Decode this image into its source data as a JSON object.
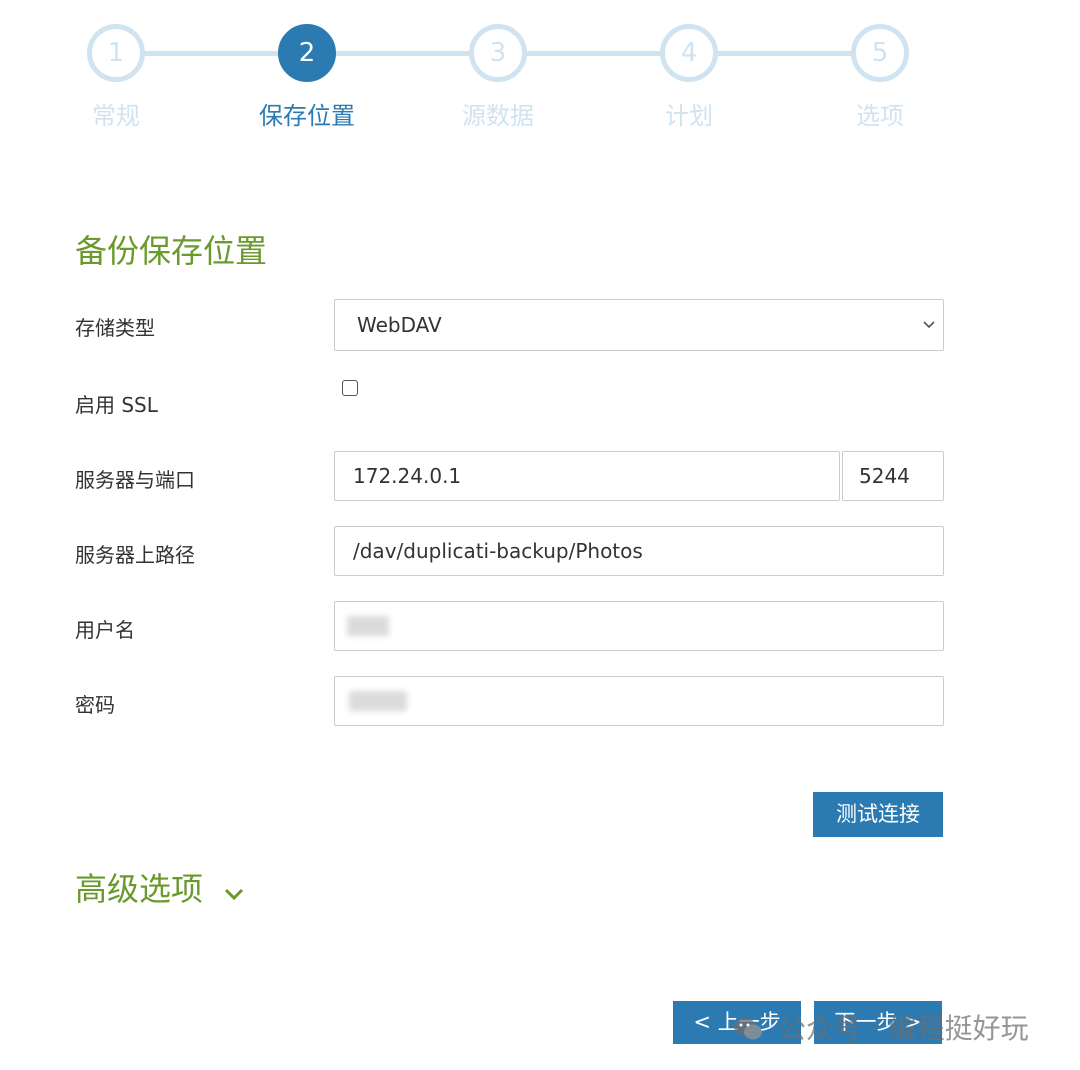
{
  "wizard": {
    "steps": [
      {
        "number": "1",
        "label": "常规"
      },
      {
        "number": "2",
        "label": "保存位置"
      },
      {
        "number": "3",
        "label": "源数据"
      },
      {
        "number": "4",
        "label": "计划"
      },
      {
        "number": "5",
        "label": "选项"
      }
    ],
    "active_step": 2
  },
  "form": {
    "title": "备份保存位置",
    "storage_type": {
      "label": "存储类型",
      "value": "WebDAV"
    },
    "ssl": {
      "label": "启用 SSL",
      "checked": false
    },
    "server": {
      "label": "服务器与端口",
      "host": "172.24.0.1",
      "port": "5244"
    },
    "path": {
      "label": "服务器上路径",
      "value": "/dav/duplicati-backup/Photos"
    },
    "username": {
      "label": "用户名"
    },
    "password": {
      "label": "密码"
    },
    "test_button": "测试连接"
  },
  "advanced": {
    "label": "高级选项"
  },
  "nav": {
    "prev": "< 上一步",
    "next": "下一步 >"
  },
  "watermark": {
    "text": "公众号 · 编程挺好玩"
  },
  "colors": {
    "accent_blue": "#2b7bb2",
    "inactive_step": "#cfe3f1",
    "section_green": "#6a9a2b"
  }
}
